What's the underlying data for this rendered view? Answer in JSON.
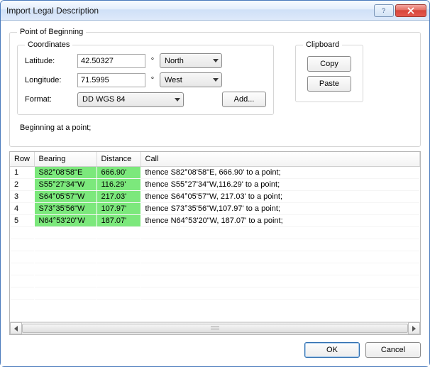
{
  "window": {
    "title": "Import Legal Description"
  },
  "pob": {
    "legend": "Point of Beginning",
    "coords_legend": "Coordinates",
    "lat_label": "Latitude:",
    "lat_value": "42.50327",
    "lat_dir": "North",
    "lon_label": "Longitude:",
    "lon_value": "71.5995",
    "lon_dir": "West",
    "deg_symbol": "°",
    "format_label": "Format:",
    "format_value": "DD WGS 84",
    "add_label": "Add..."
  },
  "clipboard": {
    "legend": "Clipboard",
    "copy_label": "Copy",
    "paste_label": "Paste"
  },
  "begin_text": "Beginning at a point;",
  "table": {
    "headers": {
      "row": "Row",
      "bearing": "Bearing",
      "distance": "Distance",
      "call": "Call"
    },
    "rows": [
      {
        "row": "1",
        "bearing": "S82°08'58\"E",
        "distance": "666.90'",
        "call": "thence S82°08'58\"E, 666.90' to a point;"
      },
      {
        "row": "2",
        "bearing": "S55°27'34\"W",
        "distance": "116.29'",
        "call": "thence S55°27'34\"W,116.29' to a point;"
      },
      {
        "row": "3",
        "bearing": "S64°05'57\"W",
        "distance": "217.03'",
        "call": "thence S64°05'57\"W, 217.03' to a point;"
      },
      {
        "row": "4",
        "bearing": "S73°35'56\"W",
        "distance": "107.97'",
        "call": "thence S73°35'56\"W,107.97' to a point;"
      },
      {
        "row": "5",
        "bearing": "N64°53'20\"W",
        "distance": "187.07'",
        "call": "thence N64°53'20\"W, 187.07' to a point;"
      }
    ]
  },
  "footer": {
    "ok_label": "OK",
    "cancel_label": "Cancel"
  }
}
